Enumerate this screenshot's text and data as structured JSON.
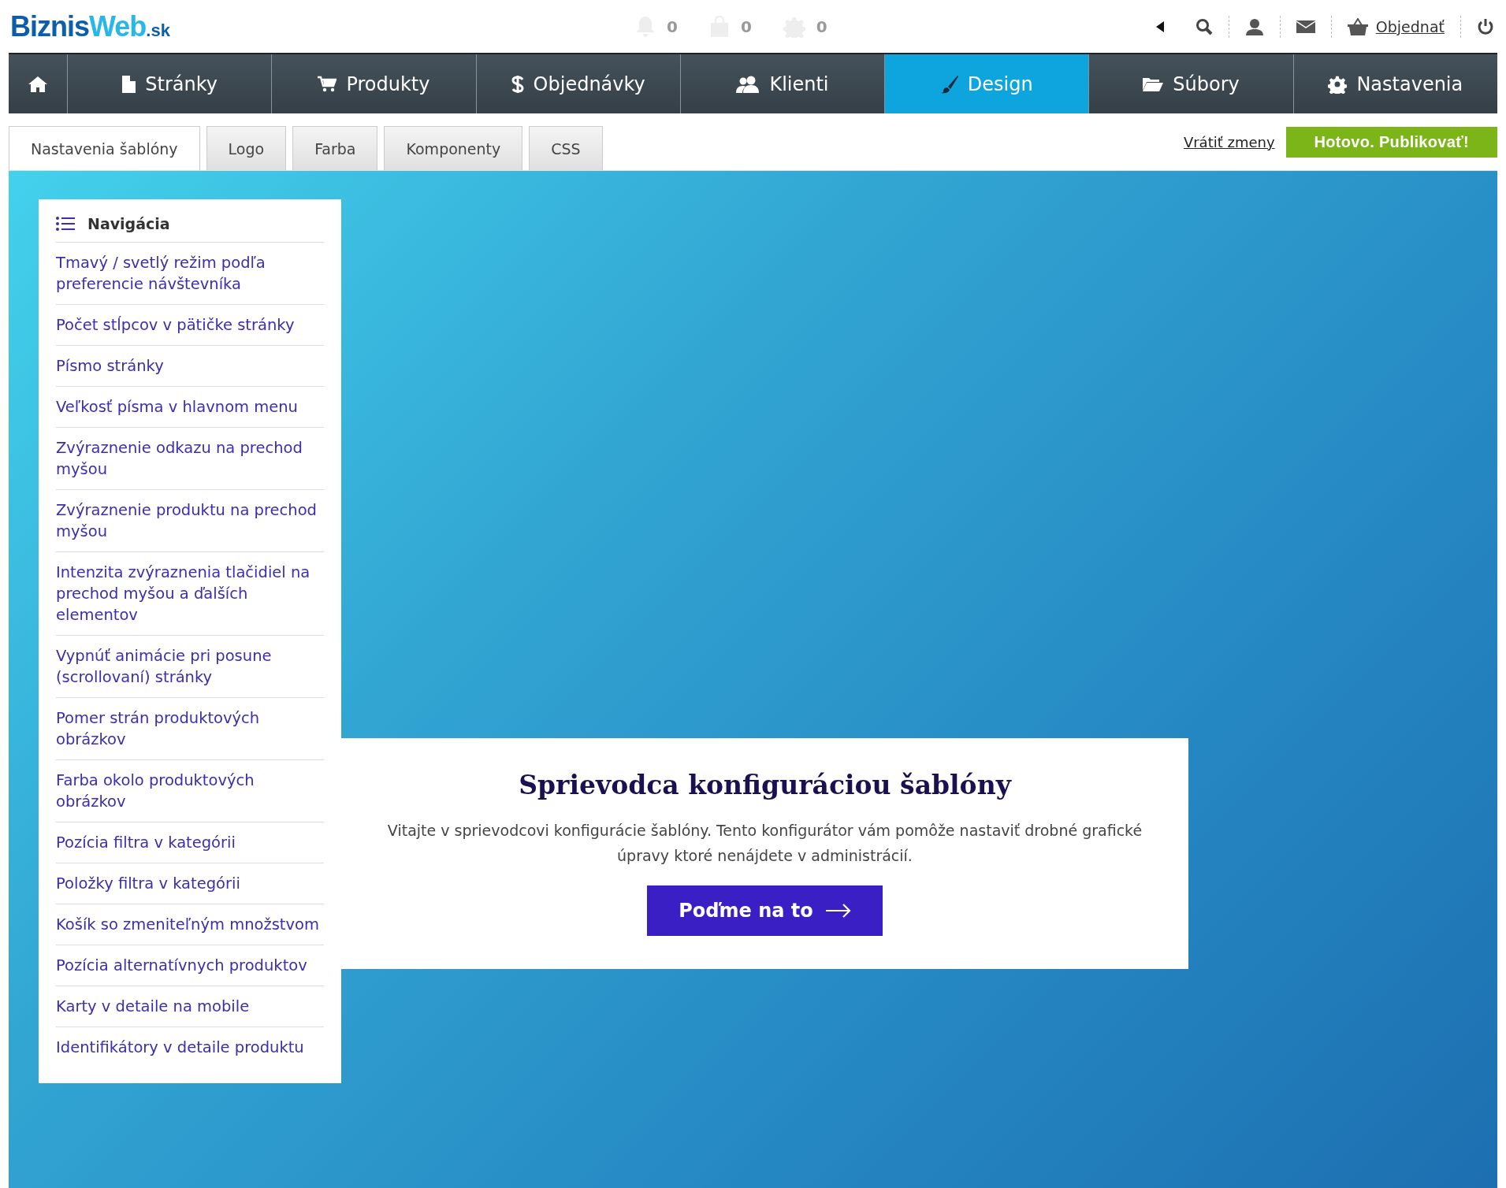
{
  "logo": {
    "main": "BiznisWeb",
    "suffix": ".sk"
  },
  "counters": [
    {
      "count": "0"
    },
    {
      "count": "0"
    },
    {
      "count": "0"
    }
  ],
  "order_link": "Objednať",
  "nav": [
    {
      "label": "Stránky",
      "selected": false
    },
    {
      "label": "Produkty",
      "selected": false
    },
    {
      "label": "Objednávky",
      "selected": false
    },
    {
      "label": "Klienti",
      "selected": false
    },
    {
      "label": "Design",
      "selected": true
    },
    {
      "label": "Súbory",
      "selected": false
    },
    {
      "label": "Nastavenia",
      "selected": false
    }
  ],
  "subtabs": [
    {
      "label": "Nastavenia šablóny",
      "selected": true
    },
    {
      "label": "Logo",
      "selected": false
    },
    {
      "label": "Farba",
      "selected": false
    },
    {
      "label": "Komponenty",
      "selected": false
    },
    {
      "label": "CSS",
      "selected": false
    }
  ],
  "revert_link": "Vrátiť zmeny",
  "publish_button": "Hotovo. Publikovať!",
  "sidebar": {
    "title": "Navigácia",
    "items": [
      "Tmavý / svetlý režim podľa preferencie návštevníka",
      "Počet stĺpcov v pätičke stránky",
      "Písmo stránky",
      "Veľkosť písma v hlavnom menu",
      "Zvýraznenie odkazu na prechod myšou",
      "Zvýraznenie produktu na prechod myšou",
      "Intenzita zvýraznenia tlačidiel na prechod myšou a ďalších elementov",
      "Vypnúť animácie pri posune (scrollovaní) stránky",
      "Pomer strán produktových obrázkov",
      "Farba okolo produktových obrázkov",
      "Pozícia filtra v kategórii",
      "Položky filtra v kategórii",
      "Košík so zmeniteľným množstvom",
      "Pozícia alternatívnych produktov",
      "Karty v detaile na mobile",
      "Identifikátory v detaile produktu"
    ]
  },
  "wizard": {
    "title": "Sprievodca konfiguráciou šablóny",
    "text": "Vitajte v sprievodcovi konfigurácie šablóny. Tento konfigurátor vám pomôže nastaviť drobné grafické úpravy ktoré nenájdete v administrácií.",
    "button": "Poďme na to"
  }
}
